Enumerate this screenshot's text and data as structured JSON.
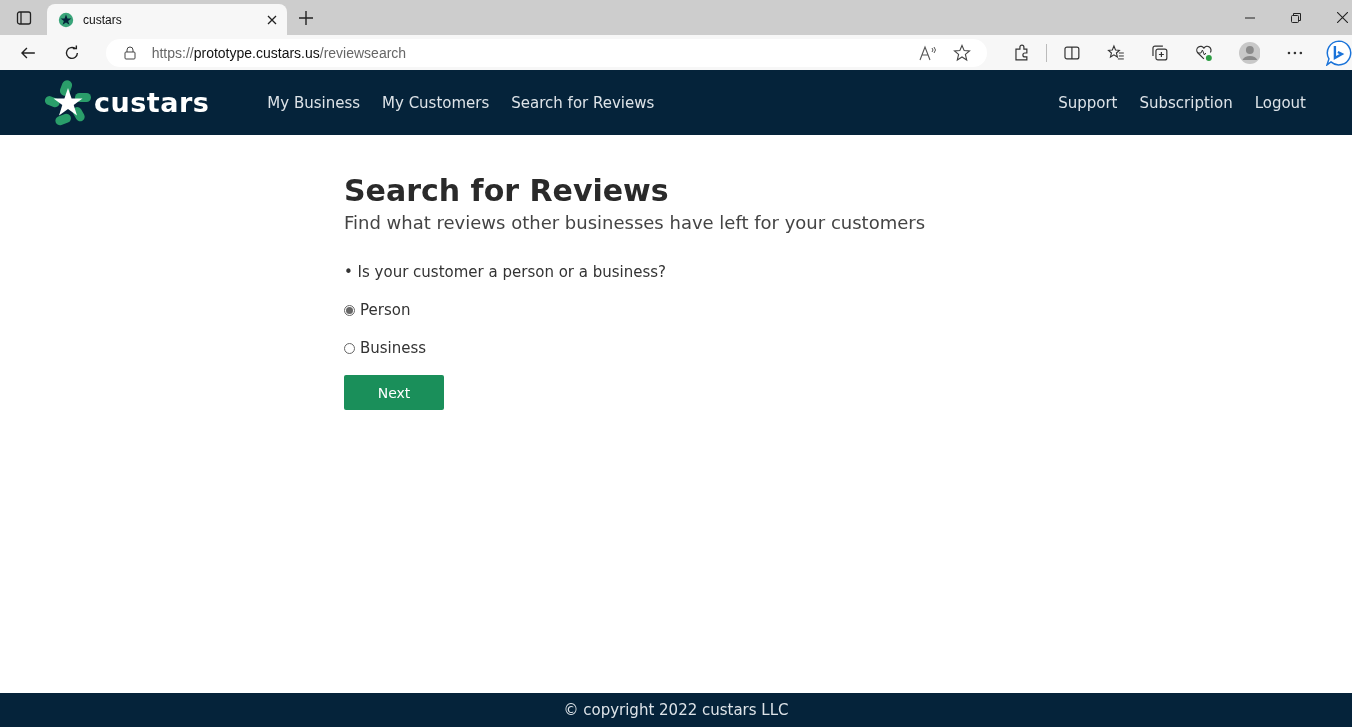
{
  "browser": {
    "tab_title": "custars",
    "url_scheme": "https://",
    "url_host": "prototype.custars.us",
    "url_path": "/reviewsearch"
  },
  "navbar": {
    "brand": "custars",
    "links": [
      {
        "label": "My Business"
      },
      {
        "label": "My Customers"
      },
      {
        "label": "Search for Reviews"
      }
    ],
    "right_links": [
      {
        "label": "Support"
      },
      {
        "label": "Subscription"
      },
      {
        "label": "Logout"
      }
    ]
  },
  "page": {
    "title": "Search for Reviews",
    "subtitle": "Find what reviews other businesses have left for your customers",
    "question": "• Is your customer a person or a business?",
    "options": [
      {
        "label": "Person",
        "selected": true
      },
      {
        "label": "Business",
        "selected": false
      }
    ],
    "button": "Next"
  },
  "footer": "© copyright 2022 custars LLC"
}
